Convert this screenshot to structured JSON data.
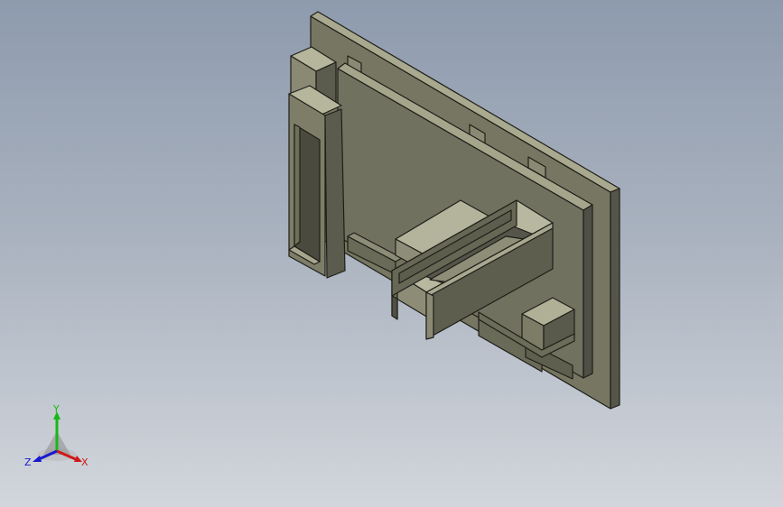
{
  "viewport": {
    "background_top": "#8e9bae",
    "background_bottom": "#d2d6dc"
  },
  "model": {
    "body_color": "#7a7a68",
    "edge_color": "#1e1e18"
  },
  "triad": {
    "x_label": "X",
    "y_label": "Y",
    "z_label": "Z",
    "x_color": "#d01818",
    "y_color": "#18b818",
    "z_color": "#1818d0"
  }
}
